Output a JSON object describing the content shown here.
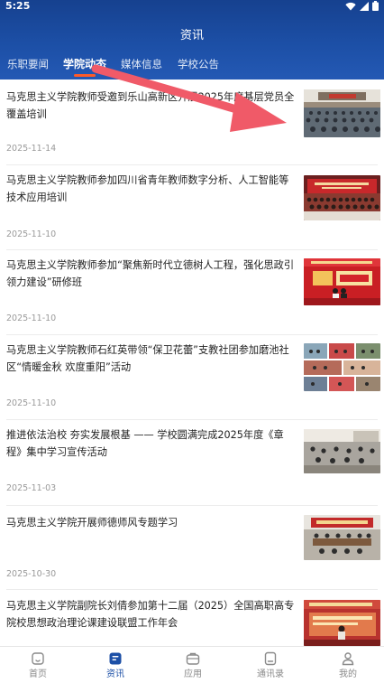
{
  "status_bar": {
    "time": "5:25",
    "icons": [
      "wifi-icon",
      "signal-icon",
      "battery-icon"
    ]
  },
  "header": {
    "title": "资讯"
  },
  "tabs": [
    {
      "label": "乐职要闻",
      "active": false
    },
    {
      "label": "学院动态",
      "active": true
    },
    {
      "label": "媒体信息",
      "active": false
    },
    {
      "label": "学校公告",
      "active": false
    }
  ],
  "colors": {
    "header": "#1c4fa6",
    "accent": "#ff5a28",
    "active_nav": "#1c4fa6",
    "arrow": "#f05a68"
  },
  "news": [
    {
      "title": "马克思主义学院教师受邀到乐山高新区开展2025年度基层党员全覆盖培训",
      "date": "2025-11-14",
      "thumb": "meeting-hall-photo"
    },
    {
      "title": "马克思主义学院教师参加四川省青年教师数字分析、人工智能等技术应用培训",
      "date": "2025-11-10",
      "thumb": "group-photo-red-banner"
    },
    {
      "title": "马克思主义学院教师参加“聚焦新时代立德树人工程，强化思政引领力建设”研修班",
      "date": "2025-11-10",
      "thumb": "training-banner-photo"
    },
    {
      "title": "马克思主义学院教师石红英带领“保卫花蕾”支教社团参加磨池社区“情暖金秋 欢度重阳”活动",
      "date": "2025-11-10",
      "thumb": "community-activity-collage"
    },
    {
      "title": "推进依法治校 夯实发展根基 —— 学校圆满完成2025年度《章程》集中学习宣传活动",
      "date": "2025-11-03",
      "thumb": "study-session-photo"
    },
    {
      "title": "马克思主义学院开展师德师风专题学习",
      "date": "2025-10-30",
      "thumb": "conference-room-photo"
    },
    {
      "title": "马克思主义学院副院长刘倩参加第十二届（2025）全国高职高专院校思想政治理论课建设联盟工作年会",
      "date": "",
      "thumb": "stage-presentation-photo"
    }
  ],
  "bottom_nav": [
    {
      "label": "首页",
      "icon": "home-icon",
      "active": false
    },
    {
      "label": "资讯",
      "icon": "news-icon",
      "active": true
    },
    {
      "label": "应用",
      "icon": "apps-icon",
      "active": false
    },
    {
      "label": "通讯录",
      "icon": "contacts-icon",
      "active": false
    },
    {
      "label": "我的",
      "icon": "profile-icon",
      "active": false
    }
  ]
}
